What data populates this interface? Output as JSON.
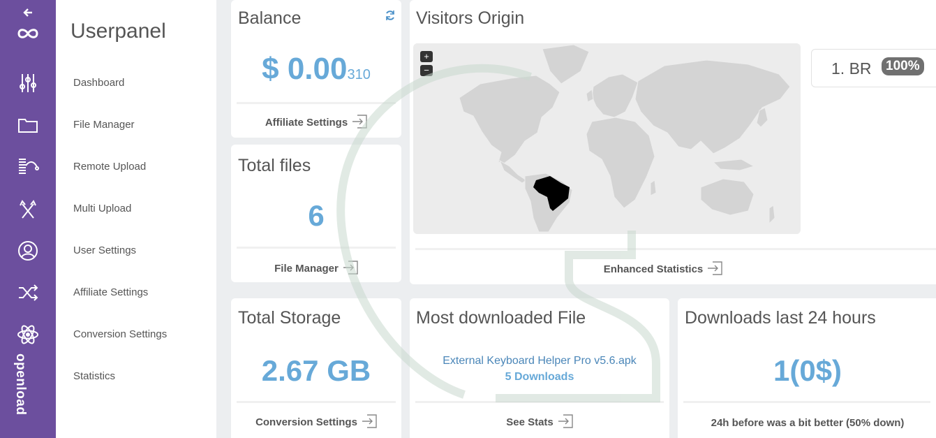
{
  "brand": {
    "logo_text": "openload"
  },
  "rail_icons": [
    "back-arrow-icon",
    "infinity-logo-icon",
    "sliders-icon",
    "folder-icon",
    "remote-upload-icon",
    "multi-upload-icon",
    "user-icon",
    "shuffle-icon",
    "atom-icon"
  ],
  "sidebar": {
    "title": "Userpanel",
    "items": [
      {
        "label": "Dashboard"
      },
      {
        "label": "File Manager"
      },
      {
        "label": "Remote Upload"
      },
      {
        "label": "Multi Upload"
      },
      {
        "label": "User Settings"
      },
      {
        "label": "Affiliate Settings"
      },
      {
        "label": "Conversion Settings"
      },
      {
        "label": "Statistics"
      }
    ]
  },
  "balance": {
    "title": "Balance",
    "amount": "$ 0.00",
    "amount_small": "310",
    "link": "Affiliate Settings"
  },
  "files": {
    "title": "Total files",
    "value": "6",
    "link": "File Manager"
  },
  "visitors": {
    "title": "Visitors Origin",
    "zoom_in": "+",
    "zoom_out": "−",
    "top_country": "1. BR",
    "top_percent": "100%",
    "link": "Enhanced Statistics",
    "highlight_color": "#000000",
    "land_color": "#d4d4d4"
  },
  "storage": {
    "title": "Total Storage",
    "value": "2.67 GB",
    "link": "Conversion Settings"
  },
  "most_downloaded": {
    "title": "Most downloaded File",
    "file_name": "External Keyboard Helper Pro v5.6.apk",
    "downloads": "5 Downloads",
    "link": "See Stats"
  },
  "downloads24": {
    "title": "Downloads last 24 hours",
    "value": "1(0$)",
    "note": "24h before was a bit better (50% down)"
  },
  "colors": {
    "rail": "#6c4f9e",
    "accent": "#67a9d8"
  }
}
